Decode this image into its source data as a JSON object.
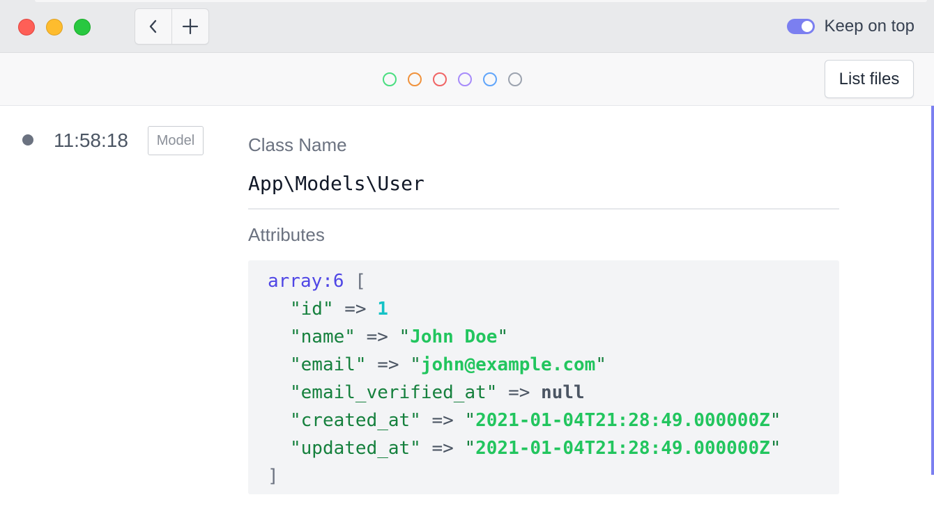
{
  "window": {
    "nav": {
      "back_icon": "chevron-left-icon",
      "add_icon": "plus-icon"
    },
    "keep_on_top": {
      "label": "Keep on top",
      "enabled": true,
      "color": "#7b7ff0"
    }
  },
  "toolbar": {
    "color_filters": [
      {
        "name": "green",
        "color": "#4ade80"
      },
      {
        "name": "orange",
        "color": "#f0923c"
      },
      {
        "name": "red",
        "color": "#f06464"
      },
      {
        "name": "purple",
        "color": "#a78bfa"
      },
      {
        "name": "blue",
        "color": "#60a5fa"
      },
      {
        "name": "gray",
        "color": "#9ca3af"
      }
    ],
    "list_files_label": "List files"
  },
  "entry": {
    "time": "11:58:18",
    "badge": "Model",
    "class_label": "Class Name",
    "class_value": "App\\Models\\User",
    "attributes_label": "Attributes",
    "dump": {
      "open": "array:6",
      "open_bracket": "[",
      "close_bracket": "]",
      "rows": [
        {
          "key": "\"id\"",
          "arrow": "=>",
          "value": "1",
          "kind": "num"
        },
        {
          "key": "\"name\"",
          "arrow": "=>",
          "value": "John Doe",
          "kind": "str"
        },
        {
          "key": "\"email\"",
          "arrow": "=>",
          "value": "john@example.com",
          "kind": "str"
        },
        {
          "key": "\"email_verified_at\"",
          "arrow": "=>",
          "value": "null",
          "kind": "null"
        },
        {
          "key": "\"created_at\"",
          "arrow": "=>",
          "value": "2021-01-04T21:28:49.000000Z",
          "kind": "str"
        },
        {
          "key": "\"updated_at\"",
          "arrow": "=>",
          "value": "2021-01-04T21:28:49.000000Z",
          "kind": "str"
        }
      ]
    }
  }
}
